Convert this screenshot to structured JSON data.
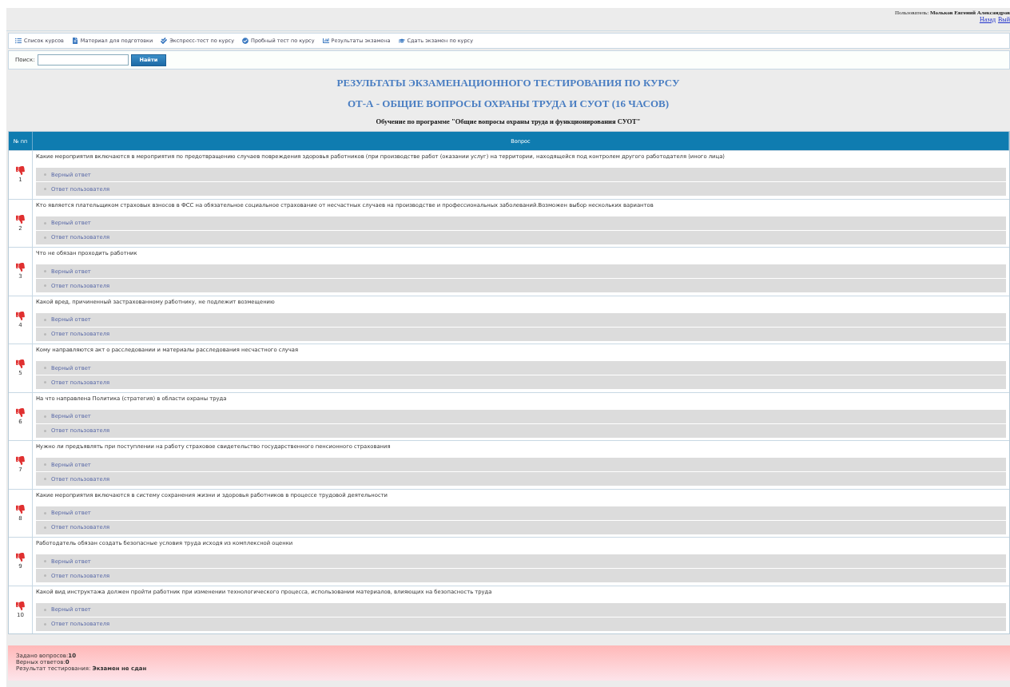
{
  "user": {
    "label": "Пользователь:",
    "name": "Мольков Евгений Александров",
    "links": [
      "Назад",
      "Вый"
    ]
  },
  "nav": [
    "Список курсов",
    "Материал для подготовки",
    "Экспресс-тест по курсу",
    "Пробный тест по курсу",
    "Результаты экзамена",
    "Сдать экзамен по курсу"
  ],
  "search": {
    "label": "Поиск:",
    "button": "Найти"
  },
  "title": [
    "РЕЗУЛЬТАТЫ ЭКЗАМЕНАЦИОННОГО ТЕСТИРОВАНИЯ ПО КУРСУ",
    "ОТ-А - ОБЩИЕ ВОПРОСЫ ОХРАНЫ ТРУДА И СУОТ (16 ЧАСОВ)"
  ],
  "subtitle": "Обучение по программе \"Общие вопросы охраны труда и функционирования СУОТ\"",
  "table": {
    "columns": [
      "№ пп",
      "Вопрос"
    ],
    "rows": [
      {
        "n": "1",
        "correct": false,
        "question": "Какие мероприятия включаются в мероприятия по предотвращению случаев повреждения здоровья работников (при производстве работ (оказании услуг) на территории, находящейся под контролем другого работодателя (иного лица)",
        "answers": [
          "Верный ответ",
          "Ответ пользователя"
        ]
      },
      {
        "n": "2",
        "correct": false,
        "question": "Кто является плательщиком страховых взносов в ФСС на обязательное социальное страхование от несчастных случаев на производстве и профессиональных заболеваний.Возможен выбор нескольких вариантов",
        "answers": [
          "Верный ответ",
          "Ответ пользователя"
        ]
      },
      {
        "n": "3",
        "correct": false,
        "question": "Что не обязан проходить работник",
        "answers": [
          "Верный ответ",
          "Ответ пользователя"
        ]
      },
      {
        "n": "4",
        "correct": false,
        "question": "Какой вред, причиненный застрахованному работнику, не подлежит возмещению",
        "answers": [
          "Верный ответ",
          "Ответ пользователя"
        ]
      },
      {
        "n": "5",
        "correct": false,
        "question": "Кому направляются акт о расследовании и материалы расследования несчастного случая",
        "answers": [
          "Верный ответ",
          "Ответ пользователя"
        ]
      },
      {
        "n": "6",
        "correct": false,
        "question": "На что направлена Политика (стратегия) в области охраны труда",
        "answers": [
          "Верный ответ",
          "Ответ пользователя"
        ]
      },
      {
        "n": "7",
        "correct": false,
        "question": "Нужно ли предъявлять при поступлении на работу страховое свидетельство государственного пенсионного страхования",
        "answers": [
          "Верный ответ",
          "Ответ пользователя"
        ]
      },
      {
        "n": "8",
        "correct": false,
        "question": "Какие мероприятия включаются в систему сохранения жизни и здоровья работников в процессе трудовой деятельности",
        "answers": [
          "Верный ответ",
          "Ответ пользователя"
        ]
      },
      {
        "n": "9",
        "correct": false,
        "question": "Работодатель обязан создать безопасные условия труда исходя из комплексной оценки",
        "answers": [
          "Верный ответ",
          "Ответ пользователя"
        ]
      },
      {
        "n": "10",
        "correct": false,
        "question": "Какой вид инструктажа должен пройти работник при изменении технологического процесса, использовании материалов, влияющих на безопасность труда",
        "answers": [
          "Верный ответ",
          "Ответ пользователя"
        ]
      }
    ]
  },
  "summary": {
    "passed": false,
    "lines": [
      {
        "label": "Задано вопросов:",
        "value": "10"
      },
      {
        "label": "Верных ответов:",
        "value": "0"
      },
      {
        "label": "Результат тестирования: ",
        "value": "Экзамен не сдан"
      }
    ]
  }
}
